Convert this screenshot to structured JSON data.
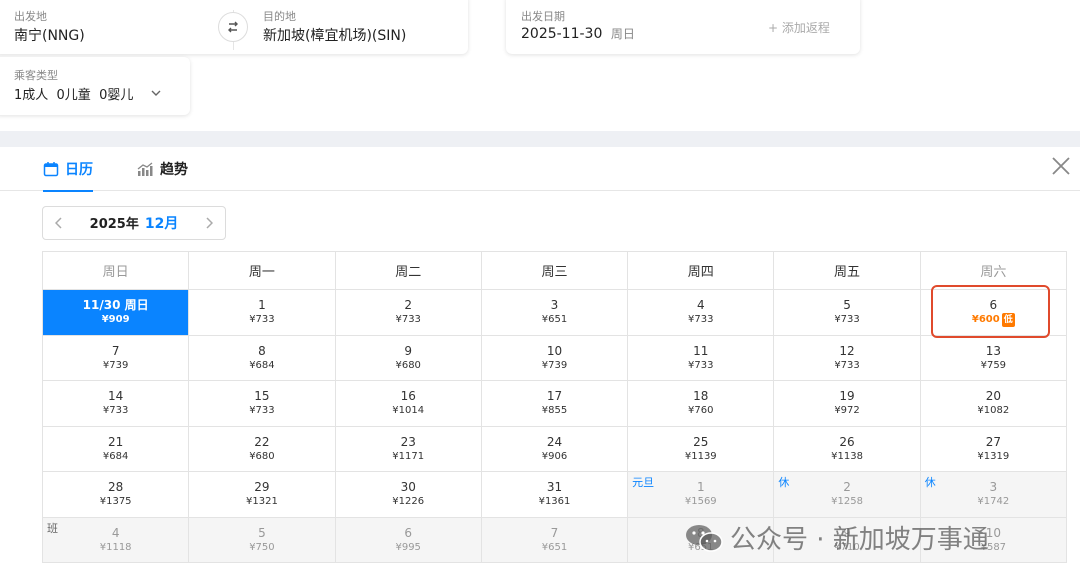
{
  "search": {
    "from_label": "出发地",
    "from_value": "南宁(NNG)",
    "to_label": "目的地",
    "to_value": "新加坡(樟宜机场)(SIN)",
    "date_label": "出发日期",
    "date_value": "2025-11-30",
    "date_weekday": "周日",
    "add_return": "+ 添加返程",
    "passenger_label": "乘客类型",
    "passenger_value": "1成人  0儿童  0婴儿"
  },
  "tabs": {
    "calendar": "日历",
    "trend": "趋势"
  },
  "month_nav": {
    "year": "2025年",
    "month": "12月"
  },
  "weekdays": [
    "周日",
    "周一",
    "周二",
    "周三",
    "周四",
    "周五",
    "周六"
  ],
  "weeks": [
    [
      {
        "d": "11/30 周日",
        "p": "¥909"
      },
      {
        "d": "1",
        "p": "¥733"
      },
      {
        "d": "2",
        "p": "¥733"
      },
      {
        "d": "3",
        "p": "¥651"
      },
      {
        "d": "4",
        "p": "¥733"
      },
      {
        "d": "5",
        "p": "¥733"
      },
      {
        "d": "6",
        "p": "¥600",
        "low": "低"
      }
    ],
    [
      {
        "d": "7",
        "p": "¥739"
      },
      {
        "d": "8",
        "p": "¥684"
      },
      {
        "d": "9",
        "p": "¥680"
      },
      {
        "d": "10",
        "p": "¥739"
      },
      {
        "d": "11",
        "p": "¥733"
      },
      {
        "d": "12",
        "p": "¥733"
      },
      {
        "d": "13",
        "p": "¥759"
      }
    ],
    [
      {
        "d": "14",
        "p": "¥733"
      },
      {
        "d": "15",
        "p": "¥733"
      },
      {
        "d": "16",
        "p": "¥1014"
      },
      {
        "d": "17",
        "p": "¥855"
      },
      {
        "d": "18",
        "p": "¥760"
      },
      {
        "d": "19",
        "p": "¥972"
      },
      {
        "d": "20",
        "p": "¥1082"
      }
    ],
    [
      {
        "d": "21",
        "p": "¥684"
      },
      {
        "d": "22",
        "p": "¥680"
      },
      {
        "d": "23",
        "p": "¥1171"
      },
      {
        "d": "24",
        "p": "¥906"
      },
      {
        "d": "25",
        "p": "¥1139"
      },
      {
        "d": "26",
        "p": "¥1138"
      },
      {
        "d": "27",
        "p": "¥1319"
      }
    ],
    [
      {
        "d": "28",
        "p": "¥1375"
      },
      {
        "d": "29",
        "p": "¥1321"
      },
      {
        "d": "30",
        "p": "¥1226"
      },
      {
        "d": "31",
        "p": "¥1361"
      },
      {
        "d": "1",
        "p": "¥1569",
        "tag": "元旦"
      },
      {
        "d": "2",
        "p": "¥1258",
        "tag": "休"
      },
      {
        "d": "3",
        "p": "¥1742",
        "tag": "休"
      }
    ],
    [
      {
        "d": "4",
        "p": "¥1118",
        "tag": "班"
      },
      {
        "d": "5",
        "p": "¥750"
      },
      {
        "d": "6",
        "p": "¥995"
      },
      {
        "d": "7",
        "p": "¥651"
      },
      {
        "d": "8",
        "p": "¥651"
      },
      {
        "d": "9",
        "p": "¥710"
      },
      {
        "d": "10",
        "p": "¥587"
      }
    ]
  ],
  "watermark": "公众号 · 新加坡万事通",
  "colors": {
    "accent": "#0a84ff",
    "low_price": "#ff7a00",
    "highlight_border": "#e04a2c"
  }
}
